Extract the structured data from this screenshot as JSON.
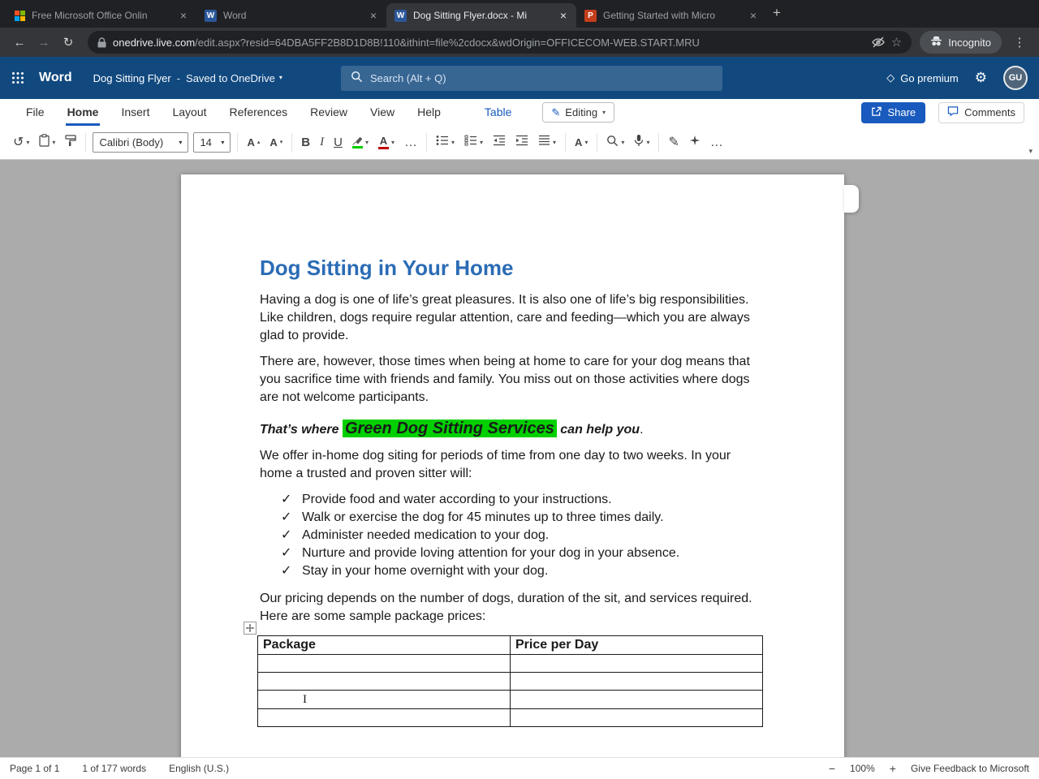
{
  "icons": {
    "close": "×",
    "new_tab": "+",
    "back": "←",
    "forward": "→",
    "reload": "↻",
    "star": "☆",
    "menu": "⋮",
    "caret": "▾",
    "gear": "⚙",
    "diamond": "◇",
    "undo": "↺",
    "ellipsis": "…",
    "check": "✓",
    "pencil": "✎",
    "bold": "B",
    "italic": "I",
    "underline": "U",
    "letter_a": "A",
    "up_triangle": "▴",
    "minus": "−",
    "plus": "+",
    "word_favicon": "W",
    "ppt_favicon": "P",
    "separator": "-",
    "ibeam": "I"
  },
  "browser": {
    "tabs": [
      {
        "title": "Free Microsoft Office Onlin"
      },
      {
        "title": "Word"
      },
      {
        "title": "Dog Sitting Flyer.docx - Mi"
      },
      {
        "title": "Getting Started with Micro"
      }
    ],
    "url_domain": "onedrive.live.com",
    "url_path": "/edit.aspx?resid=64DBA5FF2B8D1D8B!110&ithint=file%2cdocx&wdOrigin=OFFICECOM-WEB.START.MRU",
    "incognito_label": "Incognito"
  },
  "app_header": {
    "app_name": "Word",
    "doc_title": "Dog Sitting Flyer",
    "saved_status": "Saved to OneDrive",
    "search_placeholder": "Search (Alt + Q)",
    "premium_label": "Go premium",
    "avatar_initials": "GU"
  },
  "ribbon": {
    "menu_tabs": [
      "File",
      "Home",
      "Insert",
      "Layout",
      "References",
      "Review",
      "View",
      "Help"
    ],
    "contextual_tab": "Table",
    "editing_label": "Editing",
    "share_label": "Share",
    "comments_label": "Comments",
    "font_name": "Calibri (Body)",
    "font_size": "14"
  },
  "document": {
    "title": "Dog Sitting in Your Home",
    "para1": "Having a dog is one of life’s great pleasures. It is also one of life’s big responsibilities. Like children, dogs require regular attention, care and feeding—which you are always glad to provide.",
    "para2": "There are, however, those times when being at home to care for your dog means that you sacrifice time with friends and family. You miss out on those activities where dogs are not welcome participants.",
    "callout_pre": "That’s where ",
    "callout_highlight": "Green Dog Sitting Services",
    "callout_mid": " can help you",
    "callout_end": ".",
    "para3": "We offer in-home dog siting for periods of time from one day to two weeks. In your home a trusted and proven sitter will:",
    "bullets": [
      "Provide food and water according to your instructions.",
      "Walk or exercise the dog for 45 minutes up to three times daily.",
      "Administer needed medication to your dog.",
      "Nurture and provide loving attention for your dog in your absence.",
      "Stay in your home overnight with your dog."
    ],
    "para4": "Our pricing depends on the number of dogs, duration of the sit, and services required. Here are some sample package prices:",
    "table": {
      "headers": [
        "Package",
        "Price per Day"
      ],
      "empty_rows": 4
    }
  },
  "status_bar": {
    "page_info": "Page 1 of 1",
    "word_count": "1 of 177 words",
    "language": "English (U.S.)",
    "zoom": "100%",
    "feedback": "Give Feedback to Microsoft"
  },
  "colors": {
    "header_blue": "#11497f",
    "accent_blue": "#185abd",
    "heading_blue": "#2b6cb5",
    "highlight_green": "#00d000",
    "font_color_red": "#c00000",
    "share_button_blue": "#185abd"
  }
}
